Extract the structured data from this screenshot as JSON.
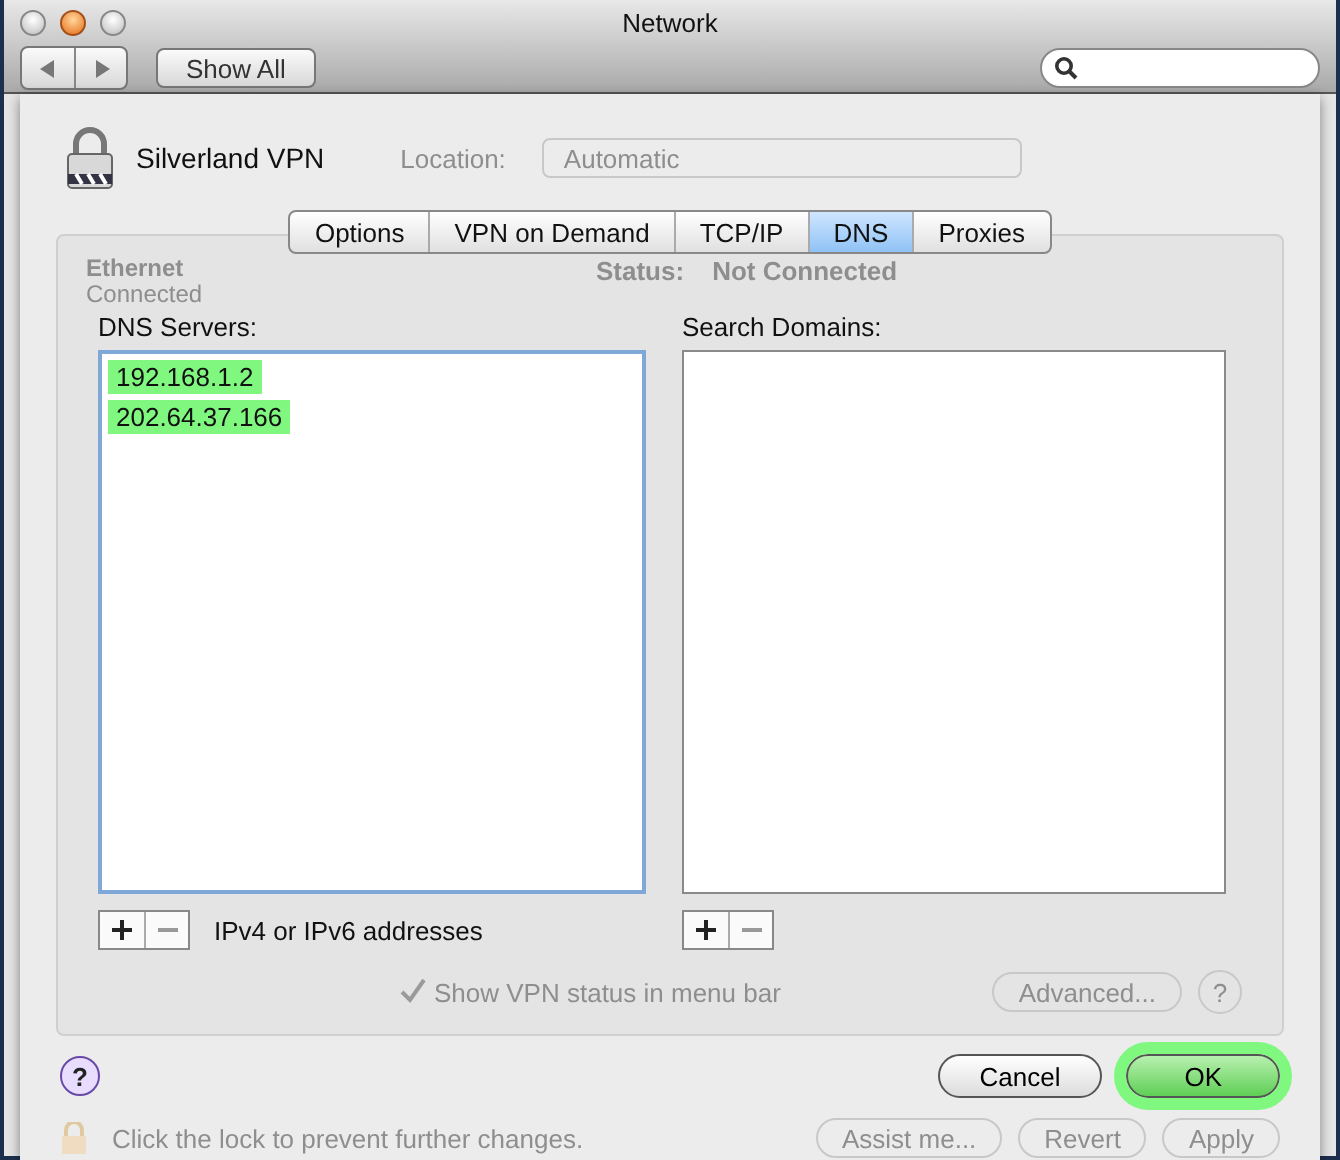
{
  "window": {
    "title": "Network"
  },
  "toolbar": {
    "show_all": "Show All"
  },
  "service": {
    "name": "Silverland VPN"
  },
  "background": {
    "location_label": "Location:",
    "location_value": "Automatic",
    "services": [
      {
        "name": "Ethernet",
        "status": "Connected"
      }
    ],
    "status_label": "Status:",
    "status_value": "Not Connected",
    "show_status": {
      "label": "Show VPN status in menu bar",
      "checked": true
    },
    "advanced": "Advanced...",
    "help": "?",
    "lock_text": "Click the lock to prevent further changes.",
    "buttons": [
      "Assist me...",
      "Revert",
      "Apply"
    ]
  },
  "tabs": [
    {
      "label": "Options",
      "selected": false
    },
    {
      "label": "VPN on Demand",
      "selected": false
    },
    {
      "label": "TCP/IP",
      "selected": false
    },
    {
      "label": "DNS",
      "selected": true
    },
    {
      "label": "Proxies",
      "selected": false
    }
  ],
  "dns_servers": {
    "label": "DNS Servers:",
    "focused": true,
    "entries": [
      {
        "address": "192.168.1.2",
        "highlighted": true
      },
      {
        "address": "202.64.37.166",
        "highlighted": true
      }
    ],
    "hint": "IPv4 or IPv6 addresses"
  },
  "search_domains": {
    "label": "Search Domains:",
    "focused": false
  },
  "help": "?",
  "buttons": [
    {
      "label": "Cancel",
      "kind": "cancel",
      "highlighted": false
    },
    {
      "label": "OK",
      "kind": "default",
      "highlighted": true
    }
  ]
}
